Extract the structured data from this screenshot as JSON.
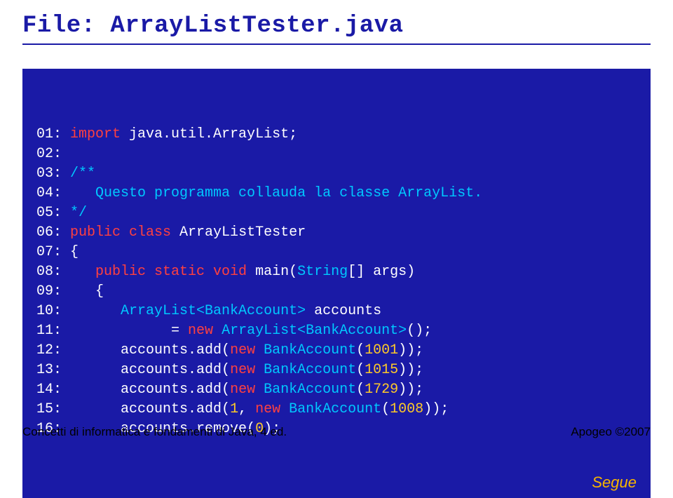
{
  "title_prefix": "File: ",
  "title_filename": "ArrayListTester.java",
  "segue": "Segue",
  "footer_left": "Concetti di informatica e fondamenti di Java, 4 ed.",
  "footer_right": "Apogeo ©2007",
  "code_lines": [
    [
      {
        "cls": "c-lineno",
        "t": "01: "
      },
      {
        "cls": "c-keyword",
        "t": "import"
      },
      {
        "cls": "c-default",
        "t": " java.util.ArrayList;"
      }
    ],
    [
      {
        "cls": "c-lineno",
        "t": "02: "
      }
    ],
    [
      {
        "cls": "c-lineno",
        "t": "03: "
      },
      {
        "cls": "c-comment",
        "t": "/**"
      }
    ],
    [
      {
        "cls": "c-lineno",
        "t": "04:    "
      },
      {
        "cls": "c-comment",
        "t": "Questo programma collauda la classe ArrayList."
      }
    ],
    [
      {
        "cls": "c-lineno",
        "t": "05: "
      },
      {
        "cls": "c-comment",
        "t": "*/"
      }
    ],
    [
      {
        "cls": "c-lineno",
        "t": "06: "
      },
      {
        "cls": "c-keyword",
        "t": "public class"
      },
      {
        "cls": "c-default",
        "t": " ArrayListTester"
      }
    ],
    [
      {
        "cls": "c-lineno",
        "t": "07: "
      },
      {
        "cls": "c-default",
        "t": "{"
      }
    ],
    [
      {
        "cls": "c-lineno",
        "t": "08:    "
      },
      {
        "cls": "c-keyword",
        "t": "public static void"
      },
      {
        "cls": "c-default",
        "t": " main("
      },
      {
        "cls": "c-type",
        "t": "String"
      },
      {
        "cls": "c-default",
        "t": "[] args)"
      }
    ],
    [
      {
        "cls": "c-lineno",
        "t": "09:    "
      },
      {
        "cls": "c-default",
        "t": "{"
      }
    ],
    [
      {
        "cls": "c-lineno",
        "t": "10:       "
      },
      {
        "cls": "c-type",
        "t": "ArrayList<BankAccount>"
      },
      {
        "cls": "c-default",
        "t": " accounts"
      }
    ],
    [
      {
        "cls": "c-lineno",
        "t": "11:             "
      },
      {
        "cls": "c-default",
        "t": "= "
      },
      {
        "cls": "c-keyword",
        "t": "new"
      },
      {
        "cls": "c-default",
        "t": " "
      },
      {
        "cls": "c-type",
        "t": "ArrayList<BankAccount>"
      },
      {
        "cls": "c-default",
        "t": "();"
      }
    ],
    [
      {
        "cls": "c-lineno",
        "t": "12:       "
      },
      {
        "cls": "c-default",
        "t": "accounts.add("
      },
      {
        "cls": "c-keyword",
        "t": "new"
      },
      {
        "cls": "c-default",
        "t": " "
      },
      {
        "cls": "c-type",
        "t": "BankAccount"
      },
      {
        "cls": "c-default",
        "t": "("
      },
      {
        "cls": "c-num",
        "t": "1001"
      },
      {
        "cls": "c-default",
        "t": "));"
      }
    ],
    [
      {
        "cls": "c-lineno",
        "t": "13:       "
      },
      {
        "cls": "c-default",
        "t": "accounts.add("
      },
      {
        "cls": "c-keyword",
        "t": "new"
      },
      {
        "cls": "c-default",
        "t": " "
      },
      {
        "cls": "c-type",
        "t": "BankAccount"
      },
      {
        "cls": "c-default",
        "t": "("
      },
      {
        "cls": "c-num",
        "t": "1015"
      },
      {
        "cls": "c-default",
        "t": "));"
      }
    ],
    [
      {
        "cls": "c-lineno",
        "t": "14:       "
      },
      {
        "cls": "c-default",
        "t": "accounts.add("
      },
      {
        "cls": "c-keyword",
        "t": "new"
      },
      {
        "cls": "c-default",
        "t": " "
      },
      {
        "cls": "c-type",
        "t": "BankAccount"
      },
      {
        "cls": "c-default",
        "t": "("
      },
      {
        "cls": "c-num",
        "t": "1729"
      },
      {
        "cls": "c-default",
        "t": "));"
      }
    ],
    [
      {
        "cls": "c-lineno",
        "t": "15:       "
      },
      {
        "cls": "c-default",
        "t": "accounts.add("
      },
      {
        "cls": "c-num",
        "t": "1"
      },
      {
        "cls": "c-default",
        "t": ", "
      },
      {
        "cls": "c-keyword",
        "t": "new"
      },
      {
        "cls": "c-default",
        "t": " "
      },
      {
        "cls": "c-type",
        "t": "BankAccount"
      },
      {
        "cls": "c-default",
        "t": "("
      },
      {
        "cls": "c-num",
        "t": "1008"
      },
      {
        "cls": "c-default",
        "t": "));"
      }
    ],
    [
      {
        "cls": "c-lineno",
        "t": "16:       "
      },
      {
        "cls": "c-default",
        "t": "accounts.remove("
      },
      {
        "cls": "c-num",
        "t": "0"
      },
      {
        "cls": "c-default",
        "t": ");"
      }
    ]
  ]
}
